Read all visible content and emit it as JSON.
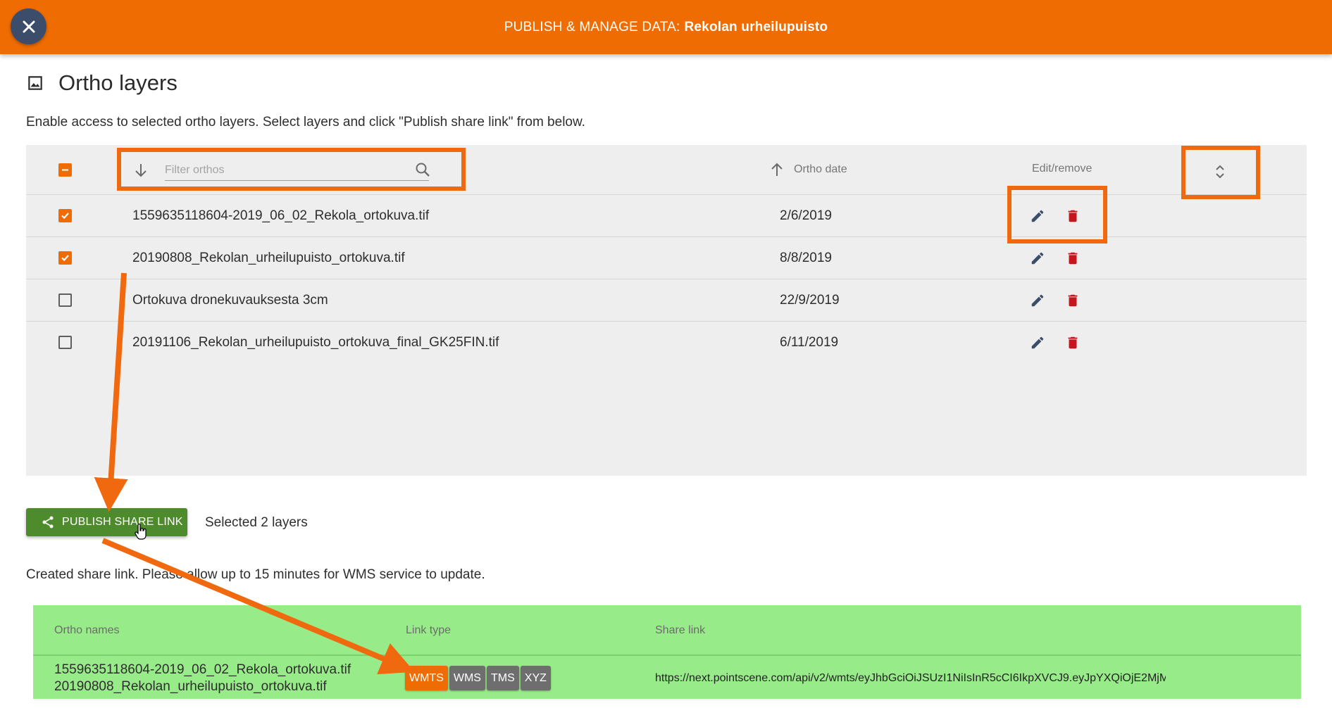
{
  "header": {
    "title_prefix": "PUBLISH & MANAGE DATA:",
    "title_project": "Rekolan urheilupuisto"
  },
  "section": {
    "title": "Ortho layers",
    "intro": "Enable access to selected ortho layers. Select layers and click \"Publish share link\" from below."
  },
  "orthos_table": {
    "filter_placeholder": "Filter orthos",
    "col_date": "Ortho date",
    "col_actions": "Edit/remove",
    "rows": [
      {
        "name": "1559635118604-2019_06_02_Rekola_ortokuva.tif",
        "date": "2/6/2019",
        "checked": true
      },
      {
        "name": "20190808_Rekolan_urheilupuisto_ortokuva.tif",
        "date": "8/8/2019",
        "checked": true
      },
      {
        "name": "Ortokuva dronekuvauksesta 3cm",
        "date": "22/9/2019",
        "checked": false
      },
      {
        "name": "20191106_Rekolan_urheilupuisto_ortokuva_final_GK25FIN.tif",
        "date": "6/11/2019",
        "checked": false
      }
    ]
  },
  "publish": {
    "button_label": "PUBLISH SHARE LINK",
    "selected_text": "Selected 2 layers",
    "created_message": "Created share link. Please allow up to 15 minutes for WMS service to update."
  },
  "share_table": {
    "col_names": "Ortho names",
    "col_type": "Link type",
    "col_link": "Share link",
    "names": [
      "1559635118604-2019_06_02_Rekola_ortokuva.tif",
      "20190808_Rekolan_urheilupuisto_ortokuva.tif"
    ],
    "link_types": [
      "WMTS",
      "WMS",
      "TMS",
      "XYZ"
    ],
    "active_type": "WMTS",
    "share_link": "https://next.pointscene.com/api/v2/wmts/eyJhbGciOiJSUzI1NiIsInR5cCI6IkpXVCJ9.eyJpYXQiOjE2MjM"
  },
  "colors": {
    "accent": "#ee6c02",
    "highlight": "#f0690f",
    "close_button": "#3b4d6b",
    "publish_button": "#4e8b2c",
    "share_table_bg": "#98eb89",
    "delete_icon": "#c4161c",
    "edit_icon": "#3b4d6b",
    "chip_inactive": "#6e6e6e"
  },
  "icons": {
    "close": "close-icon",
    "section": "image-icon",
    "sort_down": "arrow-down-icon",
    "sort_up": "arrow-up-icon",
    "search": "search-icon",
    "expand": "unfold-icon",
    "edit": "pencil-icon",
    "delete": "trash-icon",
    "share": "share-icon",
    "cursor": "hand-cursor-icon"
  }
}
